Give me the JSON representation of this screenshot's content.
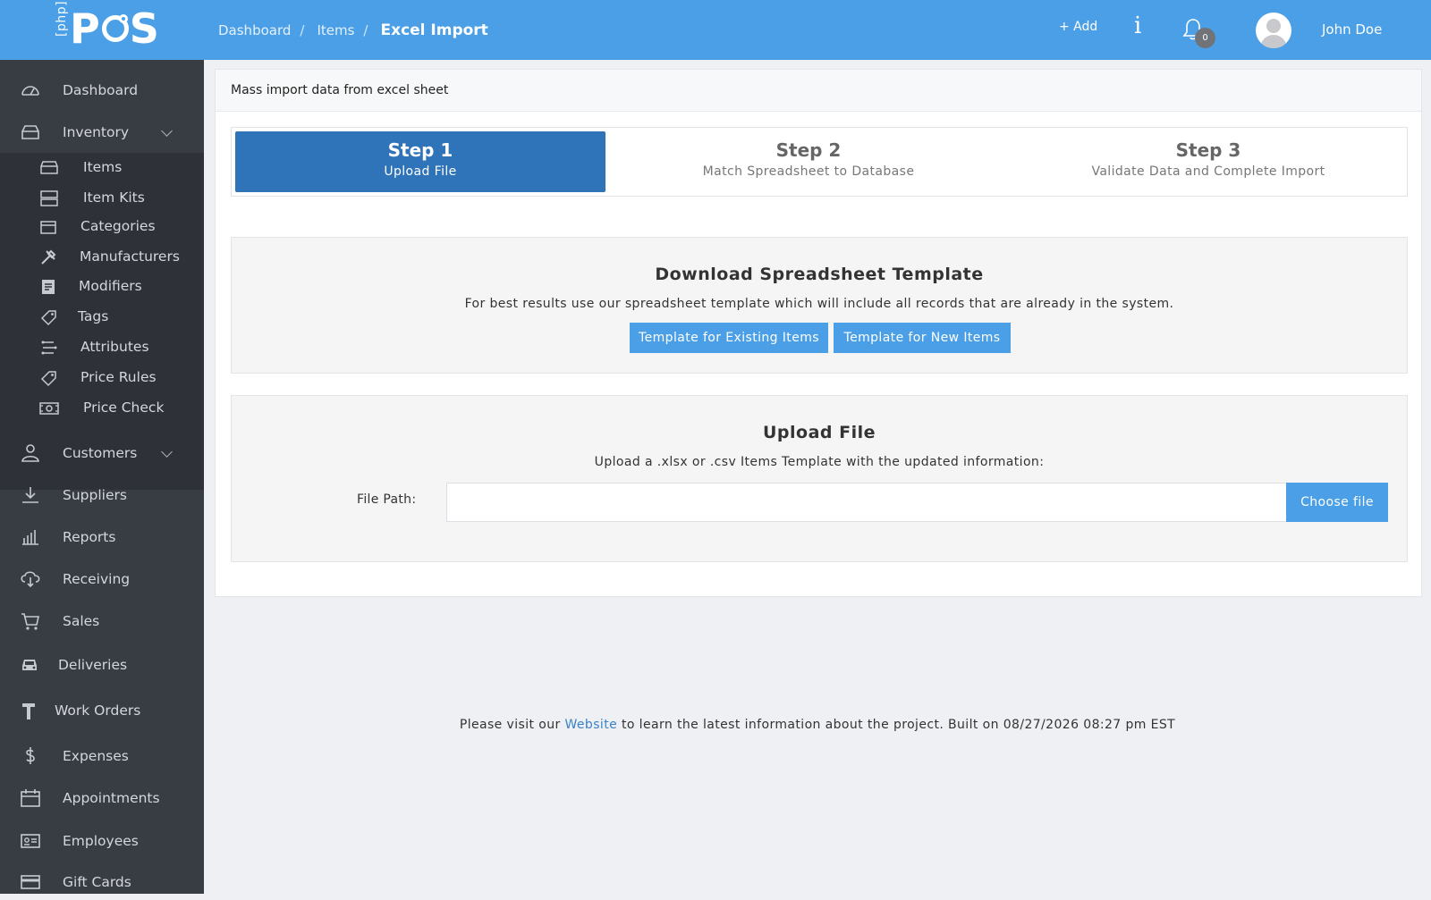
{
  "header": {
    "logo_prefix": "[php]",
    "logo_text": "POS",
    "breadcrumb": [
      "Dashboard",
      "Items",
      "Excel Import"
    ],
    "breadcrumb_sep": "/",
    "add_label": "+ Add",
    "info_label": "i",
    "notification_count": "0",
    "user_name": "John Doe"
  },
  "sidebar": {
    "items": [
      {
        "label": "Dashboard",
        "icon": "dashboard-icon"
      },
      {
        "label": "Inventory",
        "icon": "inventory-icon",
        "expandable": true
      },
      {
        "label": "Customers",
        "icon": "customers-icon",
        "expandable": true
      },
      {
        "label": "Suppliers",
        "icon": "suppliers-icon"
      },
      {
        "label": "Reports",
        "icon": "reports-icon"
      },
      {
        "label": "Receiving",
        "icon": "receiving-icon"
      },
      {
        "label": "Sales",
        "icon": "cart-icon"
      },
      {
        "label": "Deliveries",
        "icon": "car-icon"
      },
      {
        "label": "Work Orders",
        "icon": "hammer-icon"
      },
      {
        "label": "Expenses",
        "icon": "dollar-icon"
      },
      {
        "label": "Appointments",
        "icon": "calendar-icon"
      },
      {
        "label": "Employees",
        "icon": "id-card-icon"
      },
      {
        "label": "Gift Cards",
        "icon": "credit-card-icon"
      }
    ],
    "inventory_sub": [
      {
        "label": "Items",
        "icon": "items-icon"
      },
      {
        "label": "Item Kits",
        "icon": "item-kits-icon"
      },
      {
        "label": "Categories",
        "icon": "folder-icon"
      },
      {
        "label": "Manufacturers",
        "icon": "tools-icon"
      },
      {
        "label": "Modifiers",
        "icon": "document-icon"
      },
      {
        "label": "Tags",
        "icon": "tag-icon"
      },
      {
        "label": "Attributes",
        "icon": "attributes-icon"
      },
      {
        "label": "Price Rules",
        "icon": "price-tag-icon"
      },
      {
        "label": "Price Check",
        "icon": "money-icon"
      }
    ]
  },
  "main": {
    "panel_title": "Mass import data from excel sheet",
    "steps": [
      {
        "title": "Step 1",
        "subtitle": "Upload File",
        "active": true
      },
      {
        "title": "Step 2",
        "subtitle": "Match Spreadsheet to Database",
        "active": false
      },
      {
        "title": "Step 3",
        "subtitle": "Validate Data and Complete Import",
        "active": false
      }
    ],
    "template_section": {
      "title": "Download Spreadsheet Template",
      "description": "For best results use our spreadsheet template which will include all records that are already in the system.",
      "existing_button": "Template for Existing Items",
      "new_button": "Template for New Items"
    },
    "upload_section": {
      "title": "Upload File",
      "description": "Upload a .xlsx or .csv Items Template with the updated information:",
      "file_label": "File Path:",
      "file_value": "",
      "choose_button": "Choose file"
    }
  },
  "footer": {
    "prefix": "Please visit our",
    "link_text": "Website",
    "suffix": "to learn the latest information about the project. Built on 08/27/2026 08:27 pm EST"
  },
  "colors": {
    "header_bg": "#4a9fe6",
    "sidebar_bg": "#383c43",
    "submenu_bg": "#2e3238",
    "active_step": "#2f73b8",
    "button": "#4a9fe6",
    "link": "#3a82c8"
  }
}
